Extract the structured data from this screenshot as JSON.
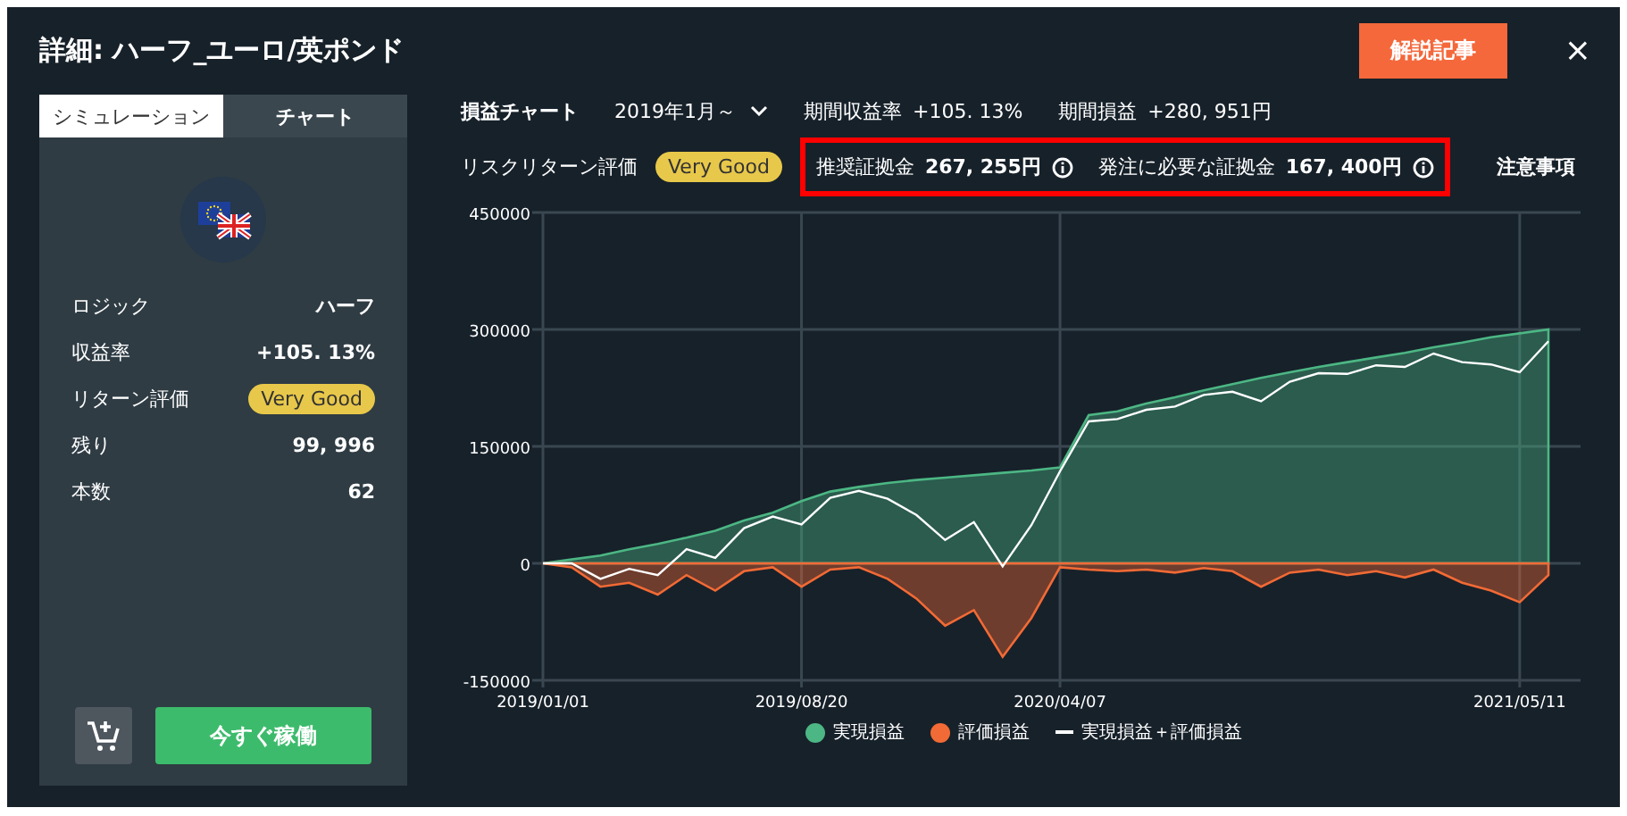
{
  "window": {
    "title": "詳細: ハーフ_ユーロ/英ポンド",
    "close": "×"
  },
  "header_button": "解説記事",
  "side_tabs": [
    {
      "label": "シミュレーション",
      "selected": true
    },
    {
      "label": "チャート",
      "selected": false
    }
  ],
  "stats": [
    {
      "label": "ロジック",
      "value": "ハーフ",
      "kind": "text"
    },
    {
      "label": "収益率",
      "value": "+105. 13%",
      "kind": "text"
    },
    {
      "label": "リターン評価",
      "value": "Very Good",
      "kind": "badge"
    },
    {
      "label": "残り",
      "value": "99, 996",
      "kind": "text"
    },
    {
      "label": "本数",
      "value": "62",
      "kind": "text"
    }
  ],
  "action_button": "今すぐ稼働",
  "chart_header": {
    "title": "損益チャート",
    "period": "2019年1月～",
    "items": [
      {
        "label": "期間収益率",
        "value": "+105. 13%"
      },
      {
        "label": "期間損益",
        "value": "+280, 951円"
      }
    ]
  },
  "risk": {
    "label": "リスクリターン評価",
    "badge": "Very Good",
    "highlighted": true,
    "margins": [
      {
        "label": "推奨証拠金",
        "value": "267, 255円"
      },
      {
        "label": "発注に必要な証拠金",
        "value": "167, 400円"
      }
    ],
    "notes_link": "注意事項"
  },
  "chart": {
    "chart_data": {
      "type": "area",
      "grid": true,
      "ylim": [
        -150000,
        450000
      ],
      "yticks": [
        -150000,
        0,
        150000,
        300000,
        450000
      ],
      "categories": [
        "2019/01/01",
        null,
        null,
        null,
        null,
        null,
        null,
        null,
        null,
        "2019/08/20",
        null,
        null,
        null,
        null,
        null,
        null,
        null,
        null,
        "2020/04/07",
        null,
        null,
        null,
        null,
        null,
        null,
        null,
        null,
        null,
        null,
        null,
        null,
        null,
        null,
        null,
        "2021/05/11",
        null
      ],
      "series": [
        {
          "name": "実現損益",
          "color": "#4cb784",
          "type": "area",
          "values": [
            0,
            5000,
            10000,
            18000,
            25000,
            33000,
            42000,
            55000,
            65000,
            80000,
            92000,
            98000,
            103000,
            107000,
            110000,
            113000,
            116000,
            119000,
            123000,
            190000,
            195000,
            205000,
            213000,
            222000,
            230000,
            238000,
            245000,
            252000,
            258000,
            264000,
            270000,
            277000,
            283000,
            290000,
            295000,
            300000
          ]
        },
        {
          "name": "評価損益",
          "color": "#f26a35",
          "type": "area",
          "values": [
            0,
            -5000,
            -30000,
            -25000,
            -40000,
            -15000,
            -35000,
            -10000,
            -5000,
            -30000,
            -8000,
            -5000,
            -20000,
            -45000,
            -80000,
            -60000,
            -120000,
            -70000,
            -5000,
            -8000,
            -10000,
            -8000,
            -12000,
            -6000,
            -10000,
            -30000,
            -12000,
            -8000,
            -15000,
            -10000,
            -18000,
            -8000,
            -25000,
            -35000,
            -50000,
            -15000
          ]
        },
        {
          "name": "実現損益＋評価損益",
          "color": "#ffffff",
          "type": "line",
          "values": [
            0,
            0,
            -20000,
            -7000,
            -15000,
            18000,
            7000,
            45000,
            60000,
            50000,
            84000,
            93000,
            83000,
            62000,
            30000,
            53000,
            -4000,
            49000,
            118000,
            182000,
            185000,
            197000,
            201000,
            216000,
            220000,
            208000,
            233000,
            244000,
            243000,
            254000,
            252000,
            269000,
            258000,
            255000,
            245000,
            285000
          ]
        }
      ]
    }
  }
}
